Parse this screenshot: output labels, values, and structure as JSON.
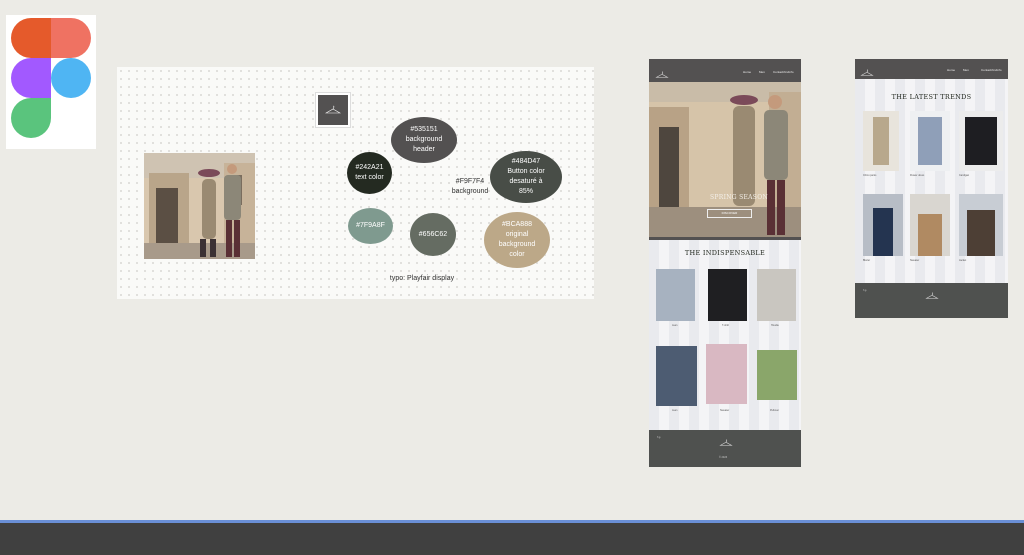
{
  "app": {
    "name": "Figma",
    "logo": "figma-logo-icon"
  },
  "moodboard": {
    "brand_mark": "hanger-logo-icon",
    "colors": [
      {
        "hex": "#535151",
        "label": "#535151\nbackground\nheader",
        "fill": "#535151"
      },
      {
        "hex": "#242A21",
        "label": "#242A21\ntext color",
        "fill": "#242a21"
      },
      {
        "hex": "#F9F7F4",
        "label": "#F9F7F4\nbackground",
        "fill": "#f9f7f4"
      },
      {
        "hex": "#484D47",
        "label": "#484D47\nButton color\ndesaturé à\n85%",
        "fill": "#484d47"
      },
      {
        "hex": "#7F9A8F",
        "label": "#7F9A8F",
        "fill": "#7f9a8f"
      },
      {
        "hex": "#656C62",
        "label": "#656C62",
        "fill": "#656c62"
      },
      {
        "hex": "#BCA888",
        "label": "#BCA888\noriginal\nbackground\ncolor",
        "fill": "#bca888"
      }
    ],
    "typo": "typo: Playfair display"
  },
  "mockup1": {
    "nav": [
      "Home",
      "Men",
      "Contact/Us/info"
    ],
    "hero_title": "SPRING SEASON",
    "hero_button": "DISCOVER",
    "section_title": "THE INDISPENSABLE",
    "products": [
      "Jean",
      "T-shirt",
      "Hoodie",
      "Jean",
      "Sweater",
      "Pullover"
    ],
    "footer_symbols": "f  ◎",
    "footer_bottom": "© 2023"
  },
  "mockup2": {
    "nav": [
      "Home",
      "Men",
      "Contact/Us/info"
    ],
    "section_title": "THE LATEST TRENDS",
    "products": [
      "Chino pants",
      "Flower dress",
      "Cardigan",
      "Blazer",
      "Sweater",
      "Jacket"
    ],
    "footer_symbols": "f  ◎"
  }
}
